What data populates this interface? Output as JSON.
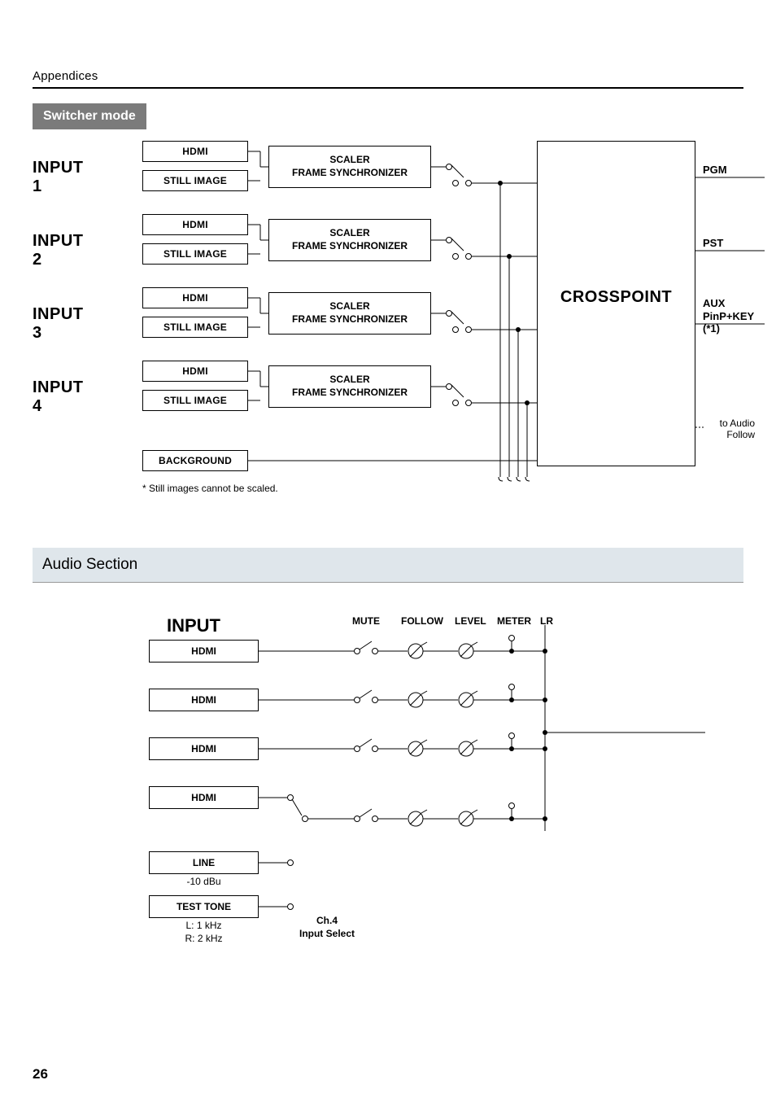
{
  "header": {
    "title": "Appendices"
  },
  "mode_label": "Switcher mode",
  "video": {
    "inputs": [
      {
        "label": "INPUT 1",
        "src_a": "HDMI",
        "src_b": "STILL IMAGE",
        "proc_a": "SCALER",
        "proc_b": "FRAME SYNCHRONIZER"
      },
      {
        "label": "INPUT 2",
        "src_a": "HDMI",
        "src_b": "STILL IMAGE",
        "proc_a": "SCALER",
        "proc_b": "FRAME SYNCHRONIZER"
      },
      {
        "label": "INPUT 3",
        "src_a": "HDMI",
        "src_b": "STILL IMAGE",
        "proc_a": "SCALER",
        "proc_b": "FRAME SYNCHRONIZER"
      },
      {
        "label": "INPUT 4",
        "src_a": "HDMI",
        "src_b": "STILL IMAGE",
        "proc_a": "SCALER",
        "proc_b": "FRAME SYNCHRONIZER"
      }
    ],
    "background_label": "BACKGROUND",
    "crosspoint": "CROSSPOINT",
    "outputs": {
      "pgm": "PGM",
      "pst": "PST",
      "aux": "AUX",
      "aux_sub": "PinP+KEY (*1)"
    },
    "audio_follow": {
      "line1": "to Audio",
      "line2": "Follow"
    },
    "footnote": "*  Still images cannot be scaled."
  },
  "audio_section_title": "Audio Section",
  "audio": {
    "input_label": "INPUT",
    "columns": {
      "mute": "MUTE",
      "follow": "FOLLOW",
      "level": "LEVEL",
      "meter": "METER",
      "lr": "LR"
    },
    "rows": [
      {
        "label": "HDMI"
      },
      {
        "label": "HDMI"
      },
      {
        "label": "HDMI"
      },
      {
        "label": "HDMI"
      }
    ],
    "line_label": "LINE",
    "line_sub": "-10 dBu",
    "testtone_label": "TEST TONE",
    "testtone_sub1": "L: 1 kHz",
    "testtone_sub2": "R: 2 kHz",
    "ch4_label1": "Ch.4",
    "ch4_label2": "Input Select"
  },
  "page": "26"
}
